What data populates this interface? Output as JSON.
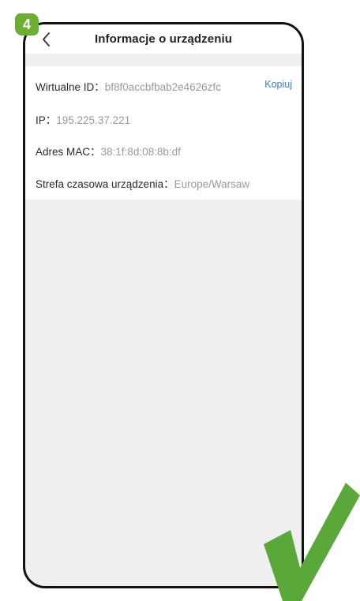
{
  "step_badge": "4",
  "header": {
    "title": "Informacje o urządzeniu",
    "back_icon": "chevron-left-icon"
  },
  "info": {
    "virtual_id": {
      "label": "Wirtualne ID：",
      "value": "bf8f0accbfbab2e4626zfc",
      "action": "Kopiuj"
    },
    "ip": {
      "label": "IP：",
      "value": "195.225.37.221"
    },
    "mac": {
      "label": "Adres MAC：",
      "value": "38:1f:8d:08:8b:df"
    },
    "timezone": {
      "label": "Strefa czasowa urządzenia：",
      "value": "Europe/Warsaw"
    }
  },
  "colors": {
    "accent_link": "#2f7fd0",
    "badge_green": "#6cae2f",
    "check_green": "#5aa83a",
    "background": "#efefef"
  },
  "overlay_icon": "checkmark-icon"
}
